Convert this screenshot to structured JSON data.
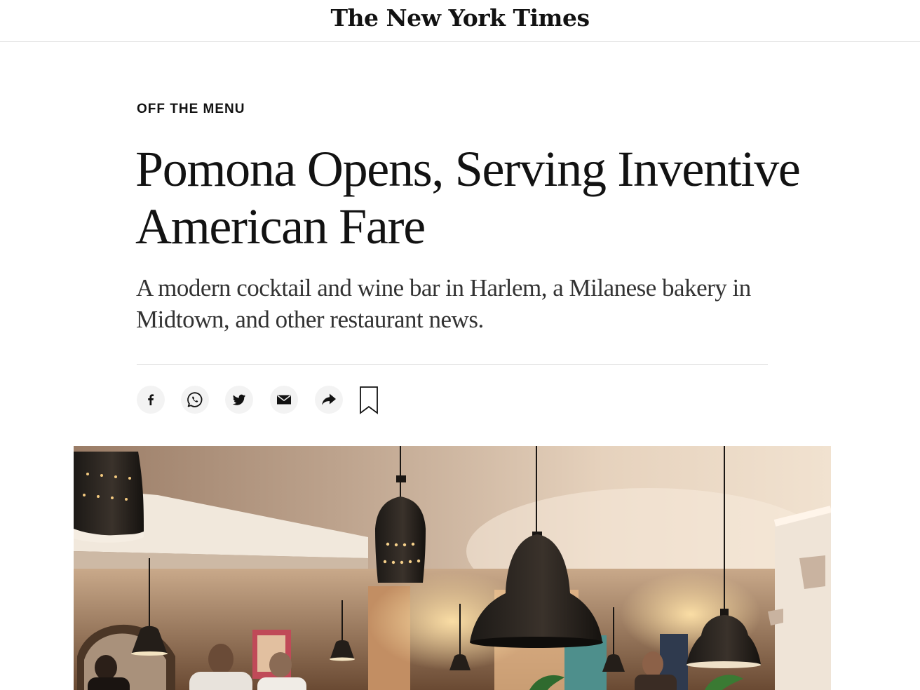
{
  "masthead": {
    "logo_text": "The New York Times"
  },
  "article": {
    "kicker": "OFF THE MENU",
    "headline": "Pomona Opens, Serving Inventive American Fare",
    "summary": "A modern cocktail and wine bar in Harlem, a Milanese bakery in Midtown, and other restaurant news."
  },
  "share_tools": [
    {
      "name": "facebook",
      "icon": "facebook-icon"
    },
    {
      "name": "whatsapp",
      "icon": "whatsapp-icon"
    },
    {
      "name": "twitter",
      "icon": "twitter-icon"
    },
    {
      "name": "email",
      "icon": "email-icon"
    },
    {
      "name": "more",
      "icon": "share-arrow-icon"
    },
    {
      "name": "save",
      "icon": "bookmark-icon"
    }
  ],
  "colors": {
    "text": "#121212",
    "summary_text": "#333333",
    "divider": "#dfdfdf",
    "share_button_bg": "#f3f3f3"
  }
}
